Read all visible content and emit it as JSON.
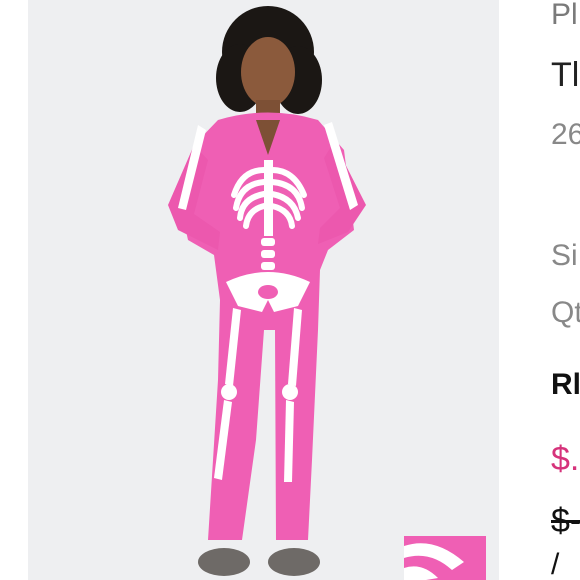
{
  "product": {
    "brand_partial": "Pl",
    "title_partial": "Tl",
    "sku_partial": "26",
    "size_label_partial": "Si",
    "qty_label_partial": "Qt",
    "section_partial": "Rl",
    "price_partial": "$.",
    "original_price_partial": "$-",
    "icon_partial": "/"
  },
  "colors": {
    "accent_price": "#d6337b",
    "onesie_pink": "#ef5fb4",
    "photo_bg": "#eeeff1"
  },
  "images": {
    "main_photo": "model wearing pink skeleton onesie",
    "thumbnail": "pink and white striped thumbnail"
  }
}
